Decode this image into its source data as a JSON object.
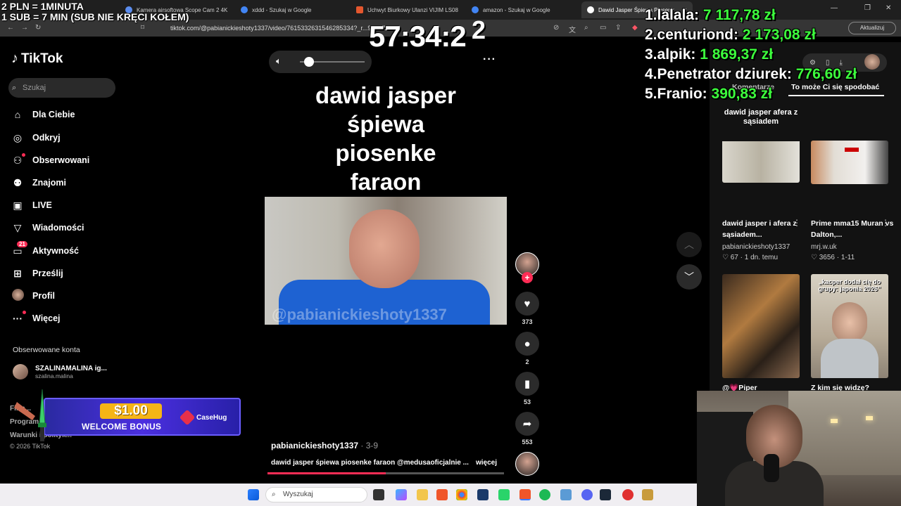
{
  "overlay": {
    "promo_line1": "2 PLN = 1MINUTA",
    "promo_line2": "1 SUB = 7 MIN (SUB NIE KRĘCI KOŁEM)",
    "timer": "57:34:2",
    "timer_extra": "2",
    "leaderboard": [
      {
        "rank": "1.",
        "name": "lalala:",
        "amount": "7 117,78 zł"
      },
      {
        "rank": "2.",
        "name": "centuriond:",
        "amount": "2 173,08 zł"
      },
      {
        "rank": "3.",
        "name": "alpik:",
        "amount": "1 869,37 zł"
      },
      {
        "rank": "4.",
        "name": "Penetrator dziurek:",
        "amount": "776,60 zł"
      },
      {
        "rank": "5.",
        "name": "Franio:",
        "amount": "390,83 zł"
      }
    ]
  },
  "browser": {
    "tabs": [
      {
        "label": "Kamera airsoftowa Scope Cam 2 4K",
        "color": "#5b8def"
      },
      {
        "label": "xddd - Szukaj w Google",
        "color": "#4285f4"
      },
      {
        "label": "Uchwyt Biurkowy Ulanzi VIJIM LS08",
        "color": "#e4572e"
      },
      {
        "label": "amazon - Szukaj w Google",
        "color": "#4285f4"
      },
      {
        "label": "Dawid Jasper Śpiewa Piosenk",
        "color": "#ffffff"
      }
    ],
    "url": "tiktok.com/@pabianickieshoty1337/video/7615332631546285334?_r...94...7D2...",
    "update_label": "Aktualizuj"
  },
  "sidebar": {
    "logo": "TikTok",
    "search_placeholder": "Szukaj",
    "items": [
      {
        "label": "Dla Ciebie",
        "icon": "home-icon"
      },
      {
        "label": "Odkryj",
        "icon": "compass-icon"
      },
      {
        "label": "Obserwowani",
        "icon": "following-icon"
      },
      {
        "label": "Znajomi",
        "icon": "friends-icon"
      },
      {
        "label": "LIVE",
        "icon": "live-icon"
      },
      {
        "label": "Wiadomości",
        "icon": "messages-icon"
      },
      {
        "label": "Aktywność",
        "icon": "activity-icon",
        "badge": "21"
      },
      {
        "label": "Prześlij",
        "icon": "upload-icon"
      },
      {
        "label": "Profil",
        "icon": "profile-icon"
      },
      {
        "label": "Więcej",
        "icon": "more-icon"
      }
    ],
    "followed_title": "Obserwowane konta",
    "followed": [
      {
        "name": "SZALINAMALINA ig...",
        "handle": "szalina.malina"
      }
    ],
    "footer": [
      "Firm...",
      "Program...",
      "Warunki i polityk..."
    ],
    "copyright": "© 2026 TikTok"
  },
  "banner": {
    "amount": "$1.00",
    "text": "WELCOME BONUS",
    "brand": "CaseHug"
  },
  "video": {
    "title_lines": [
      "dawid jasper",
      "śpiewa",
      "piosenke",
      "faraon"
    ],
    "watermark": "@pabianickieshoty1337",
    "author": "pabianickieshoty1337",
    "date": " · 3-9",
    "description": "dawid jasper śpiewa piosenke faraon @medusaoficjalnie ...",
    "more": "więcej",
    "progress": 0.5
  },
  "actions": {
    "likes": "373",
    "comments": "2",
    "saves": "53",
    "shares": "553"
  },
  "right_panel": {
    "tab_comments": "Komentarze",
    "tab_suggest": "To może Ci się spodobać",
    "videos": [
      {
        "thumb_text": "dawid jasper afera z sąsiadem",
        "title": "dawid jasper i afera z sąsiadem...",
        "channel": "pabianickieshoty1337",
        "likes": "67",
        "age": "1 dn. temu"
      },
      {
        "thumb_text": "",
        "title": "Prime mma15 Muran vs Dalton,...",
        "channel": "mrj.w.uk",
        "likes": "3656",
        "age": "1-11"
      },
      {
        "thumb_text": "",
        "title": "@💗Piper",
        "channel": "",
        "likes": "",
        "age": ""
      },
      {
        "thumb_text": "„kacper dodał cię do grupy: japonia 2026”",
        "title": "Z kim się widzę?",
        "channel": "",
        "likes": "",
        "age": ""
      }
    ]
  },
  "taskbar": {
    "search_placeholder": "Wyszukaj"
  }
}
